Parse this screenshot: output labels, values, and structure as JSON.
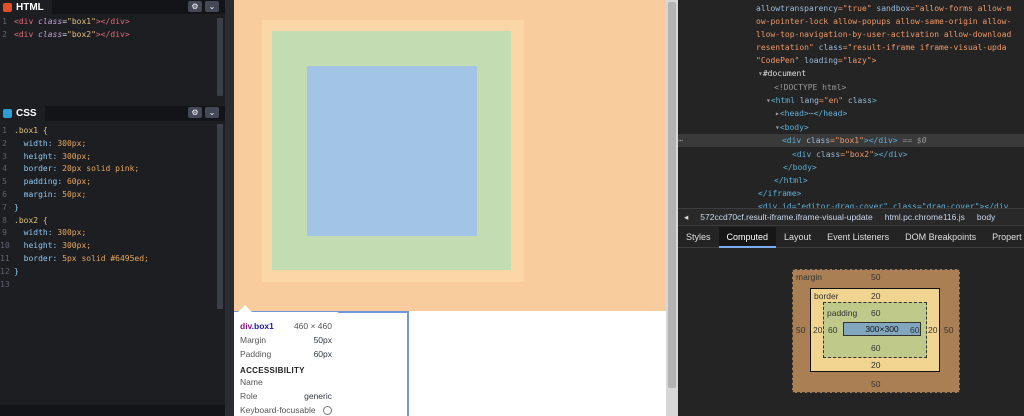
{
  "html_pane": {
    "title": "HTML",
    "lines": [
      {
        "num": "1",
        "open_a": "<div ",
        "attr": "class",
        "eq": "=",
        "val": "\"box1\"",
        "close_a": "></div>"
      },
      {
        "num": "2",
        "open_a": "<div ",
        "attr": "class",
        "eq": "=",
        "val": "\"box2\"",
        "close_a": "></div>"
      }
    ]
  },
  "css_pane": {
    "title": "CSS",
    "lines": [
      {
        "num": "1",
        "a": ".box1 {",
        "b": ""
      },
      {
        "num": "2",
        "a": "  width: ",
        "b": "300px;"
      },
      {
        "num": "3",
        "a": "  height: ",
        "b": "300px;"
      },
      {
        "num": "4",
        "a": "  border: ",
        "b": "20px solid pink;"
      },
      {
        "num": "5",
        "a": "  padding: ",
        "b": "60px;"
      },
      {
        "num": "6",
        "a": "  margin: ",
        "b": "50px;"
      },
      {
        "num": "7",
        "a": "}",
        "b": ""
      },
      {
        "num": "8",
        "a": ".box2 {",
        "b": ""
      },
      {
        "num": "9",
        "a": "  width: ",
        "b": "300px;"
      },
      {
        "num": "10",
        "a": "  height: ",
        "b": "300px;"
      },
      {
        "num": "11",
        "a": "  border: ",
        "b": "5px solid #6495ed;"
      },
      {
        "num": "12",
        "a": "}",
        "b": ""
      },
      {
        "num": "13",
        "a": "",
        "b": ""
      }
    ]
  },
  "settings_icon": "⚙",
  "collapse_icon": "⌄",
  "tooltip": {
    "element": "div",
    "class": ".box1",
    "size": "460 × 460",
    "margin_label": "Margin",
    "margin_value": "50px",
    "padding_label": "Padding",
    "padding_value": "60px",
    "accessibility_heading": "ACCESSIBILITY",
    "name_label": "Name",
    "role_label": "Role",
    "role_value": "generic",
    "focusable_label": "Keyboard-focusable"
  },
  "dom_tree": {
    "line1_a": "allowtransparency",
    "line1_b": "=\"true\" ",
    "line1_c": "sandbox",
    "line1_d": "=\"allow-forms allow-m",
    "line2": "ow-pointer-lock allow-popups allow-same-origin allow-",
    "line3": "llow-top-navigation-by-user-activation allow-download",
    "line4_a": "resentation\" ",
    "line4_b": "class",
    "line4_c": "=\"result-iframe iframe-visual-upda",
    "line5_a": "\"CodePen\" ",
    "line5_b": "loading",
    "line5_c": "=\"lazy\">",
    "document": "#document",
    "doctype": "<!DOCTYPE html>",
    "html_open_a": "<html ",
    "html_open_b": "lang",
    "html_open_c": "=\"en\" ",
    "html_open_d": "class",
    "html_open_e": ">",
    "head": "<head>",
    "head_ellipsis": "⋯",
    "head_close": "</head>",
    "body_open": "<body>",
    "div1_a": "<div ",
    "div1_b": "class",
    "div1_c": "=\"box1\"",
    "div1_d": "></div>",
    "div1_sel": " == $0",
    "div2_a": "<div ",
    "div2_b": "class",
    "div2_c": "=\"box2\"",
    "div2_d": "></div>",
    "body_close": "</body>",
    "html_close": "</html>",
    "iframe_close": "</iframe>",
    "cut_line": "<div id=\"editor-drag-cover\" class=\"drag-cover\"></div"
  },
  "breadcrumbs": [
    "◂",
    "572ccd70cf.result-iframe.iframe-visual-update",
    "html.pc.chrome116.js",
    "body"
  ],
  "subtabs": [
    "Styles",
    "Computed",
    "Layout",
    "Event Listeners",
    "DOM Breakpoints",
    "Propert"
  ],
  "active_subtab": "Computed",
  "box_model": {
    "margin_label": "margin",
    "margin_top": "50",
    "margin_bottom": "50",
    "margin_left": "50",
    "margin_right": "50",
    "border_label": "border",
    "border_top": "20",
    "border_bottom": "20",
    "border_left": "20",
    "border_right": "20",
    "padding_label": "padding",
    "padding_top": "60",
    "padding_bottom": "60",
    "padding_left": "60",
    "padding_right": "60",
    "content": "300×300"
  },
  "colors": {
    "box1_margin": "#f9cc9d",
    "box1_border": "#fbd7a7",
    "box1_padding": "#c3dcb1",
    "box1_content": "#a2c4e7",
    "highlight_outline": "#6f97df"
  }
}
